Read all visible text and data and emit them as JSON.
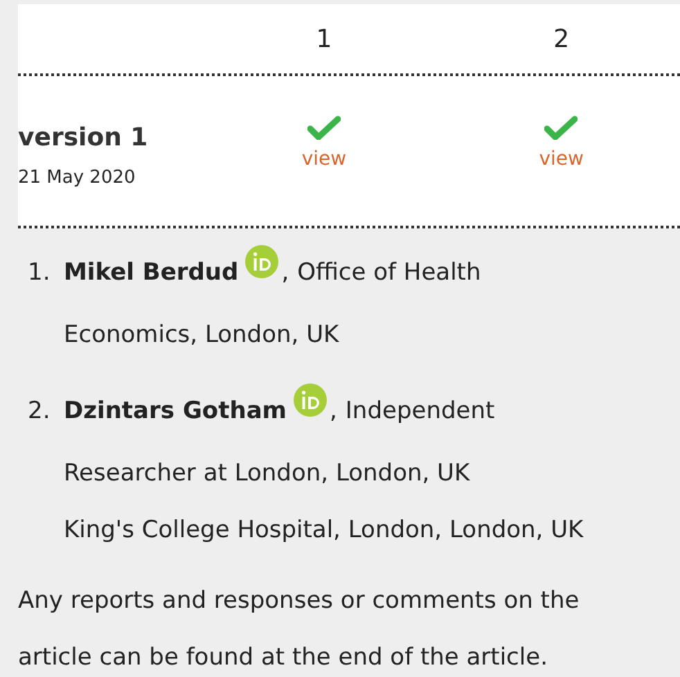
{
  "review_table": {
    "columns": [
      "1",
      "2"
    ],
    "rows": [
      {
        "version": "version 1",
        "date": "21 May 2020",
        "reports": [
          {
            "approved": true,
            "link": "view"
          },
          {
            "approved": true,
            "link": "view"
          }
        ]
      }
    ]
  },
  "authors": [
    {
      "number": "1.",
      "name": "Mikel Berdud",
      "orcid": true,
      "separator": ",",
      "affiliation_lines": [
        "Office of Health",
        "Economics, London, UK"
      ]
    },
    {
      "number": "2.",
      "name": "Dzintars Gotham",
      "orcid": true,
      "separator": ",",
      "affiliation_lines": [
        "Independent",
        "Researcher at London, London, UK",
        "King's College Hospital, London, London, UK"
      ]
    }
  ],
  "note": "Any reports and responses or comments on the article can be found at the end of the article."
}
